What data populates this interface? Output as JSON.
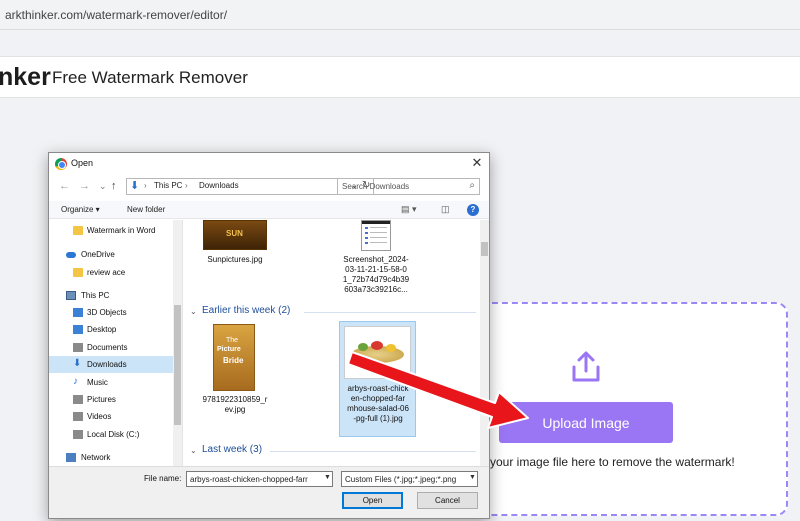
{
  "browser": {
    "url": "arkthinker.com/watermark-remover/editor/"
  },
  "site": {
    "brand": "nker",
    "product": "Free Watermark Remover"
  },
  "upload": {
    "button_label": "Upload Image",
    "hint": "your image file here to remove the watermark!",
    "accent": "#9a76f5",
    "icon": "share-upload-icon"
  },
  "dialog": {
    "title": "Open",
    "close": "✕",
    "address": {
      "crumbs": [
        "This PC",
        "Downloads"
      ]
    },
    "search_placeholder": "Search Downloads",
    "toolbar": {
      "organize": "Organize ▾",
      "new_folder": "New folder",
      "help": "?"
    },
    "nav": [
      {
        "label": "Watermark in Word",
        "icon": "folder-icon"
      },
      {
        "label": "OneDrive",
        "icon": "onedrive-icon"
      },
      {
        "label": "review ace",
        "icon": "folder-icon"
      },
      {
        "label": "This PC",
        "icon": "computer-icon"
      },
      {
        "label": "3D Objects",
        "icon": "3d-objects-icon"
      },
      {
        "label": "Desktop",
        "icon": "desktop-icon"
      },
      {
        "label": "Documents",
        "icon": "documents-icon"
      },
      {
        "label": "Downloads",
        "icon": "downloads-icon",
        "selected": true
      },
      {
        "label": "Music",
        "icon": "music-icon"
      },
      {
        "label": "Pictures",
        "icon": "pictures-icon"
      },
      {
        "label": "Videos",
        "icon": "videos-icon"
      },
      {
        "label": "Local Disk (C:)",
        "icon": "disk-icon"
      },
      {
        "label": "Network",
        "icon": "network-icon"
      }
    ],
    "files_top": [
      {
        "name": "Sunpictures.jpg"
      },
      {
        "name_lines": [
          "Screenshot_2024-",
          "03-11-21-15-58-0",
          "1_72b74d79c4b39",
          "603a73c39216c..."
        ]
      }
    ],
    "groups": [
      {
        "title": "Earlier this week (2)"
      },
      {
        "title": "Last week (3)"
      }
    ],
    "files_week": [
      {
        "name_lines": [
          "9781922310859_r",
          "ev.jpg"
        ],
        "thumb_text_1": "The",
        "thumb_text_2": "Picture",
        "thumb_text_3": "Bride"
      },
      {
        "name_lines": [
          "arbys-roast-chick",
          "en-chopped-far",
          "mhouse-salad-06",
          "-pg-full (1).jpg"
        ],
        "selected": true
      }
    ],
    "file_name_label": "File name:",
    "file_name_value": "arbys-roast-chicken-chopped-farr",
    "file_type": "Custom Files (*.jpg;*.jpeg;*.png",
    "open_label": "Open",
    "cancel_label": "Cancel"
  }
}
